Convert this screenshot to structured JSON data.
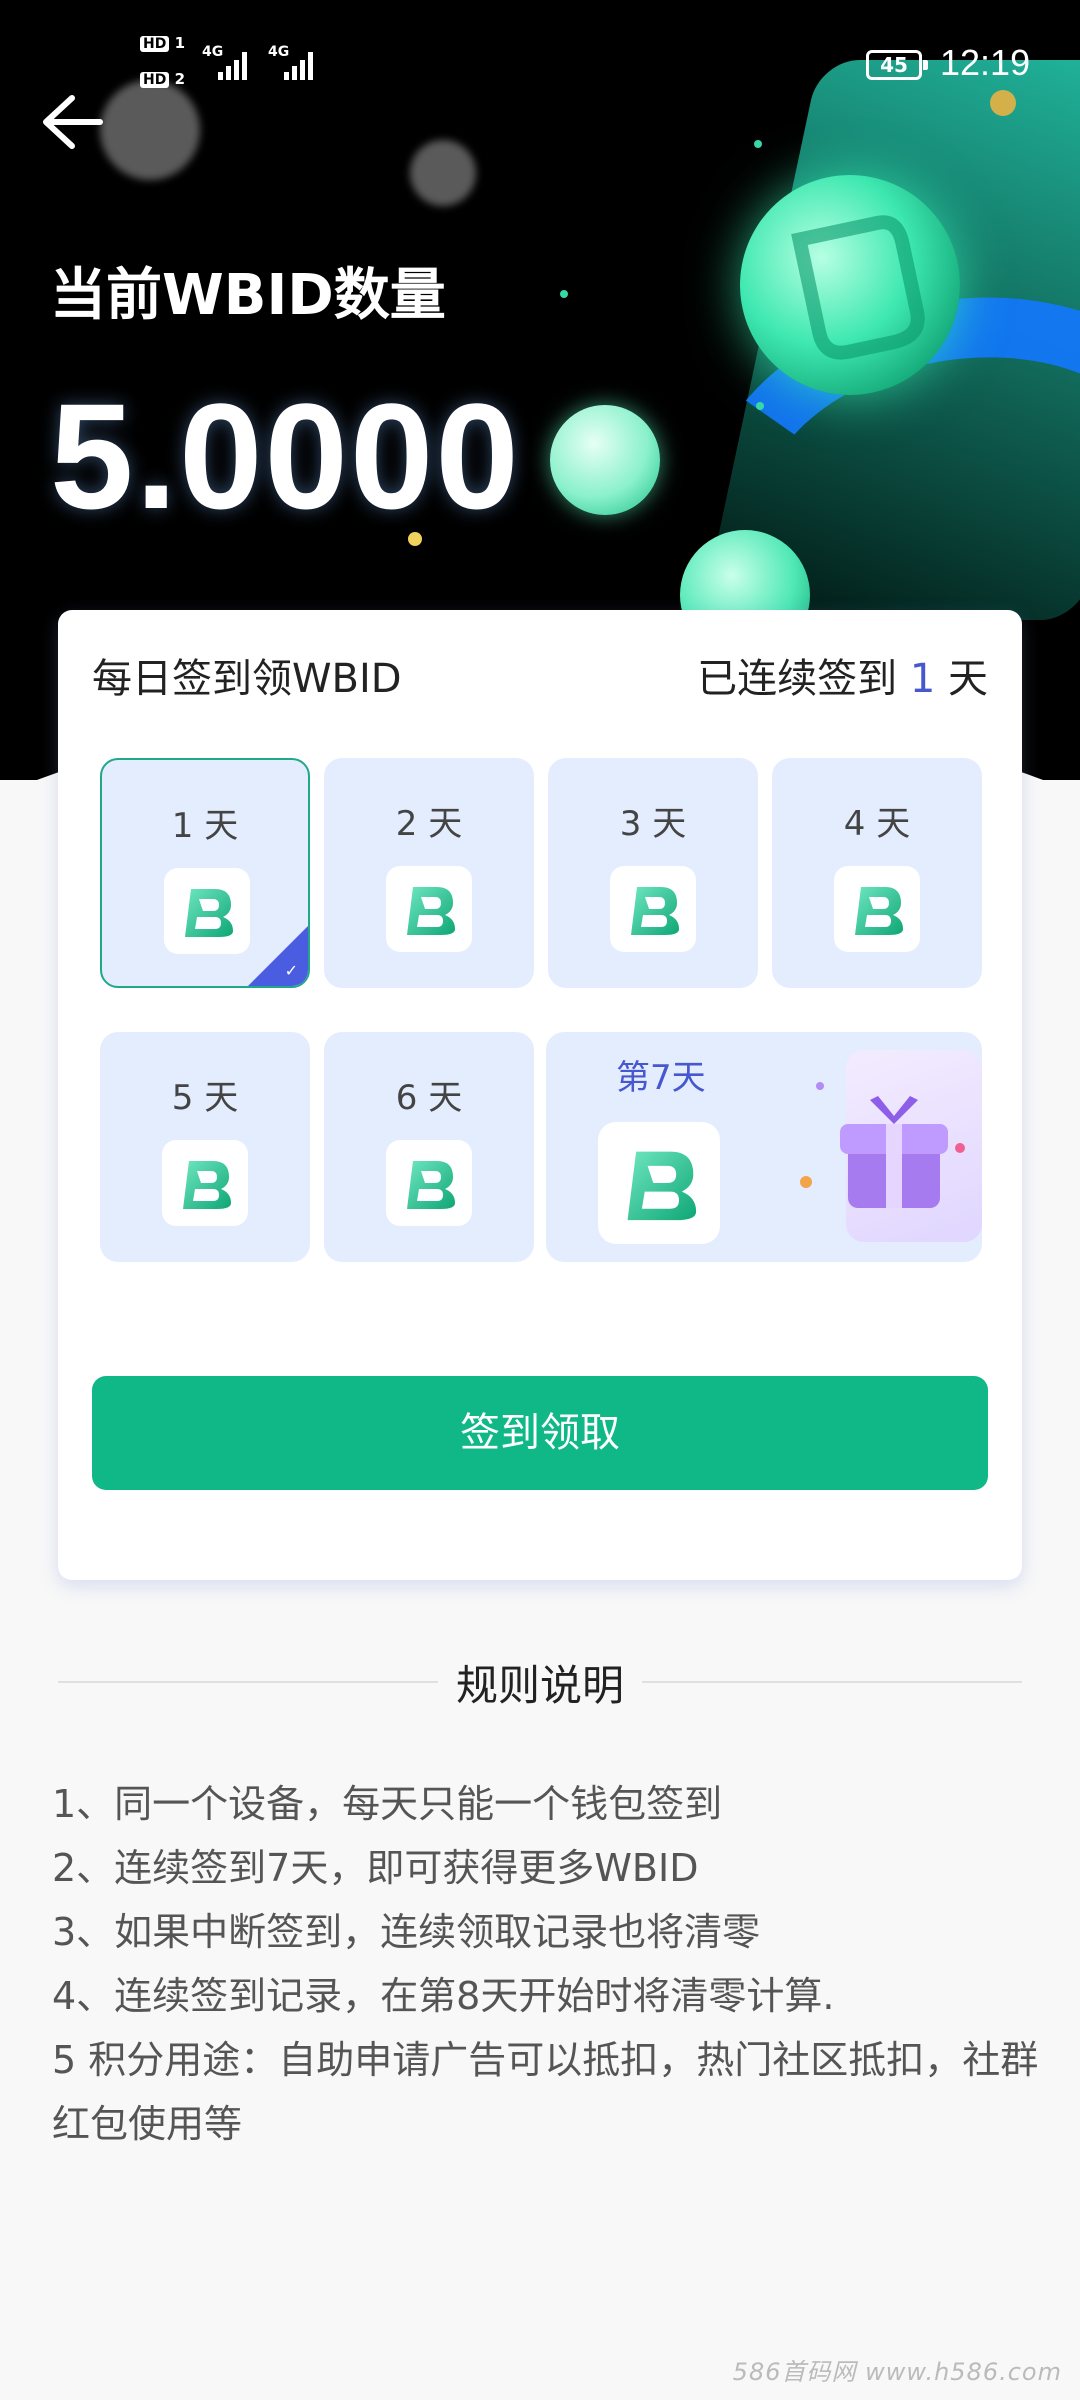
{
  "status_bar": {
    "sim1": "HD",
    "sim1_num": "1",
    "sim2": "HD",
    "sim2_num": "2",
    "net1": "4G",
    "net2": "4G",
    "battery": "45",
    "time": "12:19"
  },
  "header": {
    "back_icon": "arrow-left-icon",
    "wbid_label": "当前WBID数量",
    "wbid_value": "5.0000"
  },
  "checkin": {
    "title": "每日签到领WBID",
    "streak_prefix": "已连续签到",
    "streak_days": "1",
    "streak_suffix": "天",
    "days": [
      {
        "label": "1 天",
        "checked": true
      },
      {
        "label": "2 天",
        "checked": false
      },
      {
        "label": "3 天",
        "checked": false
      },
      {
        "label": "4 天",
        "checked": false
      },
      {
        "label": "5 天",
        "checked": false
      },
      {
        "label": "6 天",
        "checked": false
      }
    ],
    "day7_label": "第7天",
    "button_label": "签到领取"
  },
  "rules": {
    "title": "规则说明",
    "items": [
      "1、同一个设备，每天只能一个钱包签到",
      "2、连续签到7天，即可获得更多WBID",
      "3、如果中断签到，连续领取记录也将清零",
      "4、连续签到记录，在第8天开始时将清零计算.",
      "5 积分用途：自助申请广告可以抵扣，热门社区抵扣，社群红包使用等"
    ]
  },
  "watermark": "586首码网 www.h586.com",
  "colors": {
    "accent_green": "#10b887",
    "accent_blue": "#4657d0",
    "tile_bg": "#e3edfe"
  }
}
